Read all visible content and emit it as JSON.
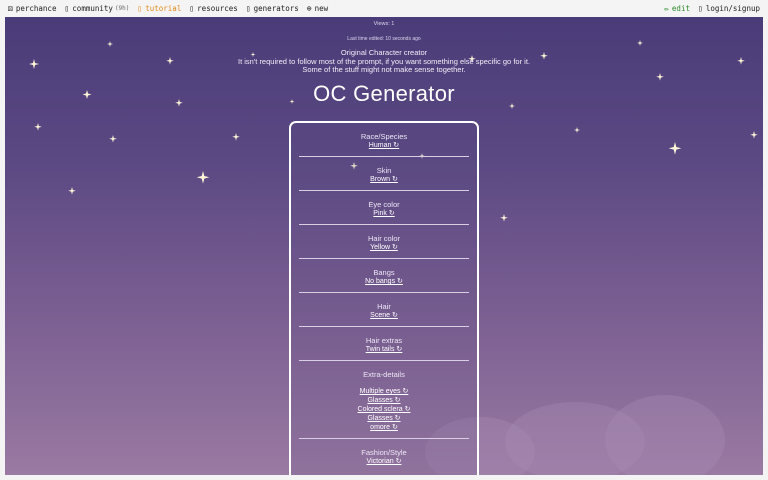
{
  "nav": {
    "brand": "perchance",
    "community": "community",
    "community_count": "(9h)",
    "tutorial": "tutorial",
    "resources": "resources",
    "generators": "generators",
    "new": "new",
    "edit": "edit",
    "login": "login/signup",
    "icons": {
      "brand": "dice-icon",
      "community": "chat-icon",
      "tutorial": "book-icon",
      "resources": "link-icon",
      "generators": "list-icon",
      "new": "plus-circle-icon",
      "edit": "pencil-icon",
      "login": "user-icon"
    }
  },
  "meta": {
    "views": "Views: 1",
    "edited": "Last time edited: 10 seconds ago"
  },
  "intro": {
    "line1": "Original Character creator",
    "line2": "It isn't required to follow most of the prompt, if you want something else specific go for it.",
    "line3": "Some of the stuff might not make sense together."
  },
  "title": "OC Generator",
  "card": {
    "race": {
      "label": "Race/Species",
      "value": "Human ↻"
    },
    "skin": {
      "label": "Skin",
      "value": "Brown ↻"
    },
    "eye": {
      "label": "Eye color",
      "value": "Pink ↻"
    },
    "hair_color": {
      "label": "Hair color",
      "value": "Yellow ↻"
    },
    "bangs": {
      "label": "Bangs",
      "value": "No bangs ↻"
    },
    "hair": {
      "label": "Hair",
      "value": "Scene ↻"
    },
    "hair_extras": {
      "label": "Hair extras",
      "value": "Twin tails ↻"
    },
    "extra_details": {
      "label": "Extra-details",
      "values": [
        "Multiple eyes ↻",
        "Glasses ↻",
        "Colored sclera ↻",
        "Glasses ↻",
        "omore ↻"
      ]
    },
    "fashion": {
      "label": "Fashion/Style",
      "value": "Victorian ↻"
    }
  },
  "colors": {
    "tutorial": "#e08a1e",
    "edit": "#2a8a2a",
    "gradient_top": "#4a3c78",
    "gradient_bottom": "#9a7aa2",
    "star": "#fff6d8"
  }
}
